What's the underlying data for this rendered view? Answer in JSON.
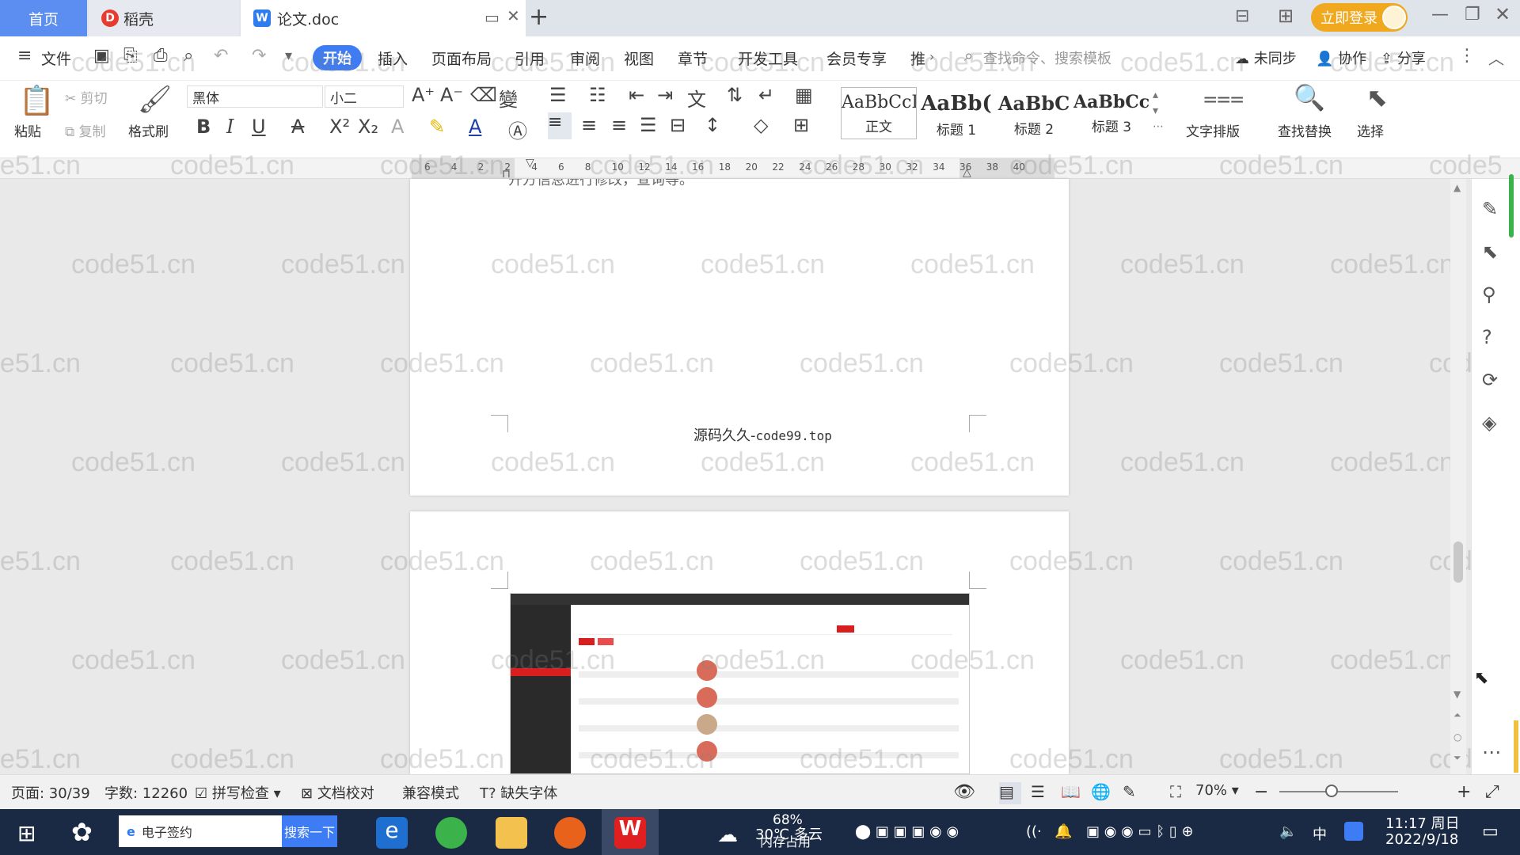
{
  "titlebar": {
    "tabs": [
      {
        "label": "首页",
        "active": false
      },
      {
        "label": "稻壳",
        "active": false
      },
      {
        "label": "论文.doc",
        "active": true
      }
    ],
    "login_label": "立即登录"
  },
  "menubar": {
    "items": [
      "文件",
      "开始",
      "插入",
      "页面布局",
      "引用",
      "审阅",
      "视图",
      "章节",
      "开发工具",
      "会员专享",
      "推"
    ],
    "search_placeholder": "查找命令、搜索模板",
    "right_items": [
      "未同步",
      "协作",
      "分享"
    ]
  },
  "ribbon": {
    "paste_label": "粘贴",
    "cut_label": "剪切",
    "copy_label": "复制",
    "format_painter_label": "格式刷",
    "font_name": "黑体",
    "font_size": "小二",
    "styles": [
      {
        "preview": "AaBbCcI",
        "label": "正文"
      },
      {
        "preview": "AaBb(",
        "label": "标题 1"
      },
      {
        "preview": "AaBbC",
        "label": "标题 2"
      },
      {
        "preview": "AaBbCcl",
        "label": "标题 3"
      }
    ],
    "text_layout_label": "文字排版",
    "find_replace_label": "查找替换",
    "select_label": "选择"
  },
  "ruler": {
    "ticks": [
      "6",
      "4",
      "2",
      "2",
      "4",
      "6",
      "8",
      "10",
      "12",
      "14",
      "16",
      "18",
      "20",
      "22",
      "24",
      "26",
      "28",
      "30",
      "32",
      "34",
      "36",
      "38",
      "40"
    ]
  },
  "document": {
    "top_partial_text": "开方信息进行修改，查询等。",
    "footer_cn": "源码久久-",
    "footer_url": "code99.top",
    "watermark": "code51.cn"
  },
  "statusbar": {
    "page": "页面: 30/39",
    "words": "字数: 12260",
    "spellcheck": "拼写检查",
    "proofread": "文档校对",
    "compat": "兼容模式",
    "missing_font": "缺失字体",
    "zoom": "70%"
  },
  "taskbar": {
    "search_text": "电子签约",
    "search_button": "搜索一下",
    "weather": "30℃ 多云",
    "memory": "68%",
    "memory_label": "内存占用",
    "ime": "中",
    "time": "11:17 周日",
    "date": "2022/9/18"
  }
}
